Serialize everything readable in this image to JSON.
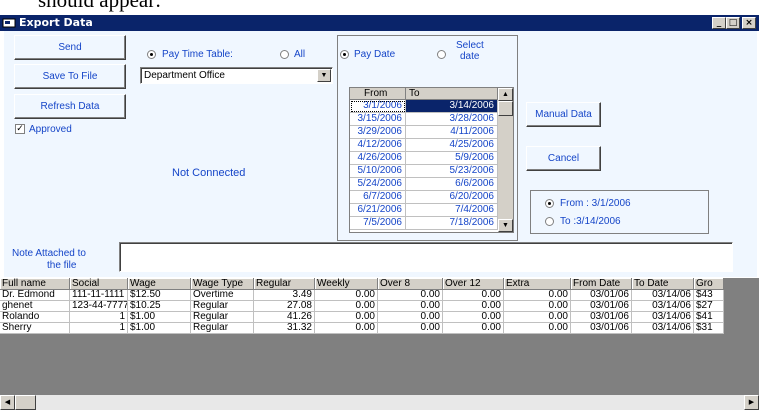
{
  "background_text": "should appear:",
  "window": {
    "title": "Export Data",
    "controls": [
      "_",
      "□",
      "×"
    ]
  },
  "buttons": {
    "send": "Send",
    "save_to_file": "Save To File",
    "refresh_data": "Refresh Data",
    "manual_data": "Manual Data",
    "cancel": "Cancel"
  },
  "approved": {
    "label": "Approved",
    "checked": true
  },
  "status": "Not Connected",
  "pay_source": {
    "pay_time_table_label": "Pay Time Table:",
    "all_label": "All",
    "selected": "pay_time_table",
    "dropdown_value": "Department Office"
  },
  "date_mode": {
    "pay_date_label": "Pay Date",
    "select_date_label_1": "Select",
    "select_date_label_2": "date",
    "selected": "pay_date"
  },
  "pay_dates": {
    "headers": [
      "From",
      "To"
    ],
    "rows": [
      [
        "3/1/2006",
        "3/14/2006"
      ],
      [
        "3/15/2006",
        "3/28/2006"
      ],
      [
        "3/29/2006",
        "4/11/2006"
      ],
      [
        "4/12/2006",
        "4/25/2006"
      ],
      [
        "4/26/2006",
        "5/9/2006"
      ],
      [
        "5/10/2006",
        "5/23/2006"
      ],
      [
        "5/24/2006",
        "6/6/2006"
      ],
      [
        "6/7/2006",
        "6/20/2006"
      ],
      [
        "6/21/2006",
        "7/4/2006"
      ],
      [
        "7/5/2006",
        "7/18/2006"
      ]
    ],
    "selected_index": 0
  },
  "range": {
    "from_label": "From : 3/1/2006",
    "to_label": "To :3/14/2006",
    "selected": "from"
  },
  "note": {
    "label_1": "Note Attached to",
    "label_2": "the file",
    "value": ""
  },
  "table": {
    "columns": [
      "Full name",
      "Social",
      "Wage",
      "Wage Type",
      "Regular",
      "Weekly",
      "Over 8",
      "Over 12",
      "Extra",
      "From Date",
      "To Date",
      "Gro"
    ],
    "rows": [
      [
        "Dr. Edmond",
        "111-11-1111",
        "$12.50",
        "Overtime",
        "3.49",
        "0.00",
        "0.00",
        "0.00",
        "0.00",
        "03/01/06",
        "03/14/06",
        "$43"
      ],
      [
        "ghenet",
        "123-44-7777",
        "$10.25",
        "Regular",
        "27.08",
        "0.00",
        "0.00",
        "0.00",
        "0.00",
        "03/01/06",
        "03/14/06",
        "$27"
      ],
      [
        "Rolando",
        "1",
        "$1.00",
        "Regular",
        "41.26",
        "0.00",
        "0.00",
        "0.00",
        "0.00",
        "03/01/06",
        "03/14/06",
        "$41"
      ],
      [
        "Sherry",
        "1",
        "$1.00",
        "Regular",
        "31.32",
        "0.00",
        "0.00",
        "0.00",
        "0.00",
        "03/01/06",
        "03/14/06",
        "$31"
      ]
    ]
  },
  "colors": {
    "title_bar": "#0a246a",
    "panel_background": "#f0f7ff",
    "label_text": "#1545c8",
    "selection": "#0a246a",
    "grid_empty": "#808080"
  }
}
